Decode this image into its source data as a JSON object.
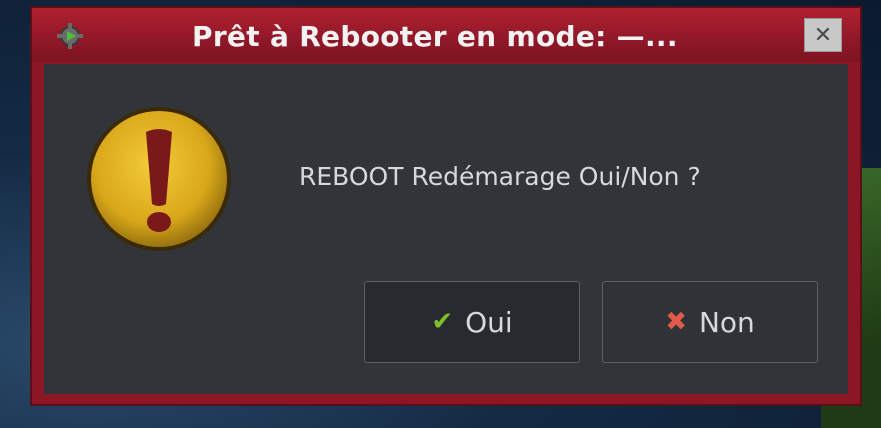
{
  "window": {
    "title": "Prêt à Rebooter en mode: —...",
    "close_glyph": "✕",
    "app_icon": "gear-arrow-icon"
  },
  "dialog": {
    "icon": "exclamation-warning-icon",
    "message": "REBOOT Redémarage Oui/Non ?",
    "buttons": [
      {
        "label": "Oui",
        "icon": "check-icon",
        "icon_glyph": "✔",
        "icon_color": "#7fbf2a"
      },
      {
        "label": "Non",
        "icon": "cross-icon",
        "icon_glyph": "✖",
        "icon_color": "#e15a4a"
      }
    ]
  },
  "colors": {
    "titlebar": "#a01c2c",
    "content_bg": "#313539",
    "warning_yellow": "#e2b521",
    "warning_mark": "#7a1a18"
  }
}
